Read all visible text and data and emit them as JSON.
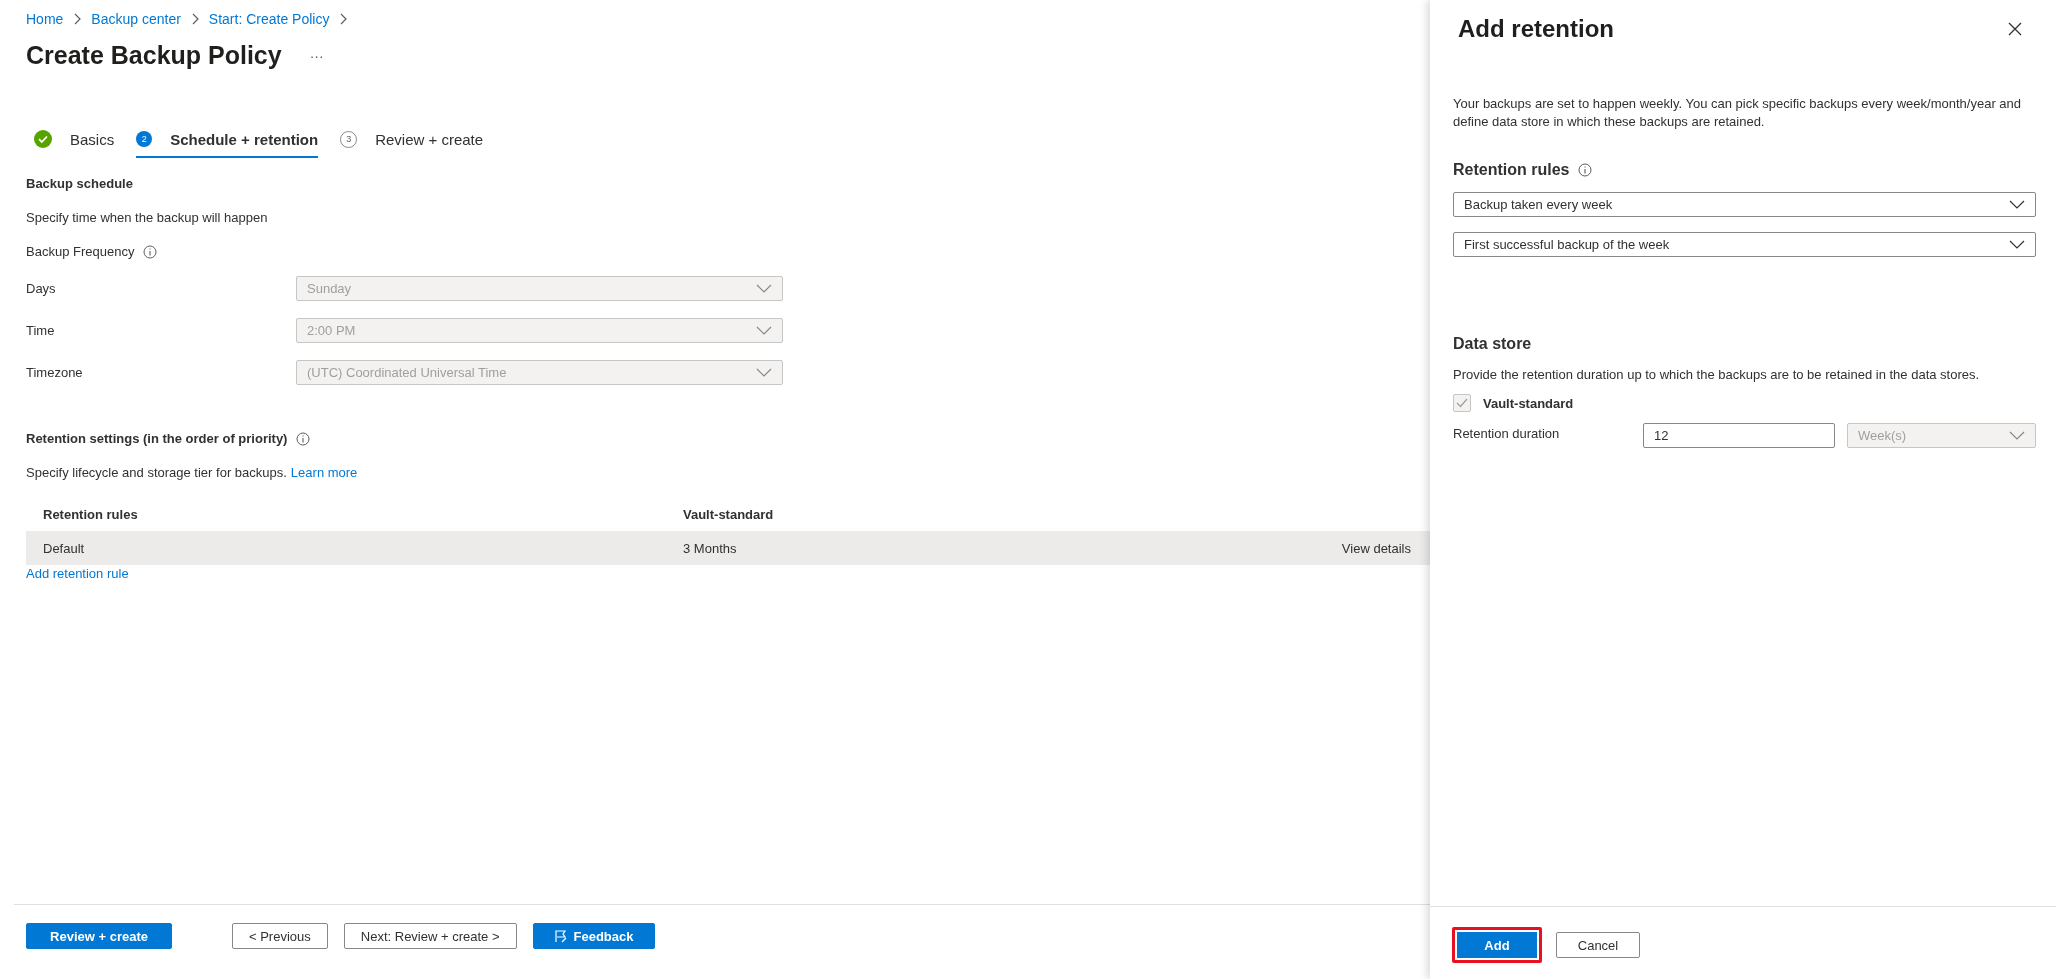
{
  "breadcrumb": [
    "Home",
    "Backup center",
    "Start: Create Policy"
  ],
  "page_title": "Create Backup Policy",
  "more_label": "···",
  "steps": [
    {
      "label": "Basics",
      "kind": "done",
      "selected": false
    },
    {
      "number": "2",
      "label": "Schedule + retention",
      "kind": "current",
      "selected": true
    },
    {
      "number": "3",
      "label": "Review + create",
      "kind": "pending",
      "selected": false
    }
  ],
  "schedule": {
    "heading": "Backup schedule",
    "description": "Specify time when the backup will happen",
    "frequency_label": "Backup Frequency",
    "fields": [
      {
        "label": "Days",
        "value": "Sunday",
        "disabled": true
      },
      {
        "label": "Time",
        "value": "2:00 PM",
        "disabled": true
      },
      {
        "label": "Timezone",
        "value": "(UTC) Coordinated Universal Time",
        "disabled": true
      }
    ]
  },
  "retention": {
    "heading": "Retention settings (in the order of priority)",
    "description": "Specify lifecycle and storage tier for backups.",
    "link": "Learn more",
    "table": {
      "columns": [
        "Retention rules",
        "Vault-standard"
      ],
      "rows": [
        {
          "cells": [
            "Default",
            "3 Months"
          ],
          "action": "View details",
          "selected": true
        }
      ]
    },
    "add_link": "Add retention rule"
  },
  "footer_buttons": [
    {
      "label": "Review + create",
      "kind": "primary"
    },
    {
      "label": "< Previous",
      "kind": "secondary"
    },
    {
      "label": "Next: Review + create >",
      "kind": "secondary"
    },
    {
      "label": "Feedback",
      "kind": "feedback"
    }
  ],
  "panel": {
    "title": "Add retention",
    "description": "Your backups are set to happen weekly. You can pick specific backups every week/month/year and define data store in which these backups are retained.",
    "rules_heading": "Retention rules",
    "rule_dropdowns": [
      {
        "value": "Backup taken every week",
        "disabled": false
      },
      {
        "value": "First successful backup of the week",
        "disabled": false
      }
    ],
    "store_heading": "Data store",
    "store_description": "Provide the retention duration up to which the backups are to be retained in the data stores.",
    "store": {
      "label": "Vault-standard",
      "checked": true,
      "disabled": true
    },
    "duration_label": "Retention duration",
    "duration_value": "12",
    "unit": {
      "value": "Week(s)",
      "disabled": true
    },
    "buttons": [
      {
        "label": "Add",
        "kind": "primary",
        "highlighted": true
      },
      {
        "label": "Cancel",
        "kind": "secondary",
        "highlighted": false
      }
    ]
  }
}
